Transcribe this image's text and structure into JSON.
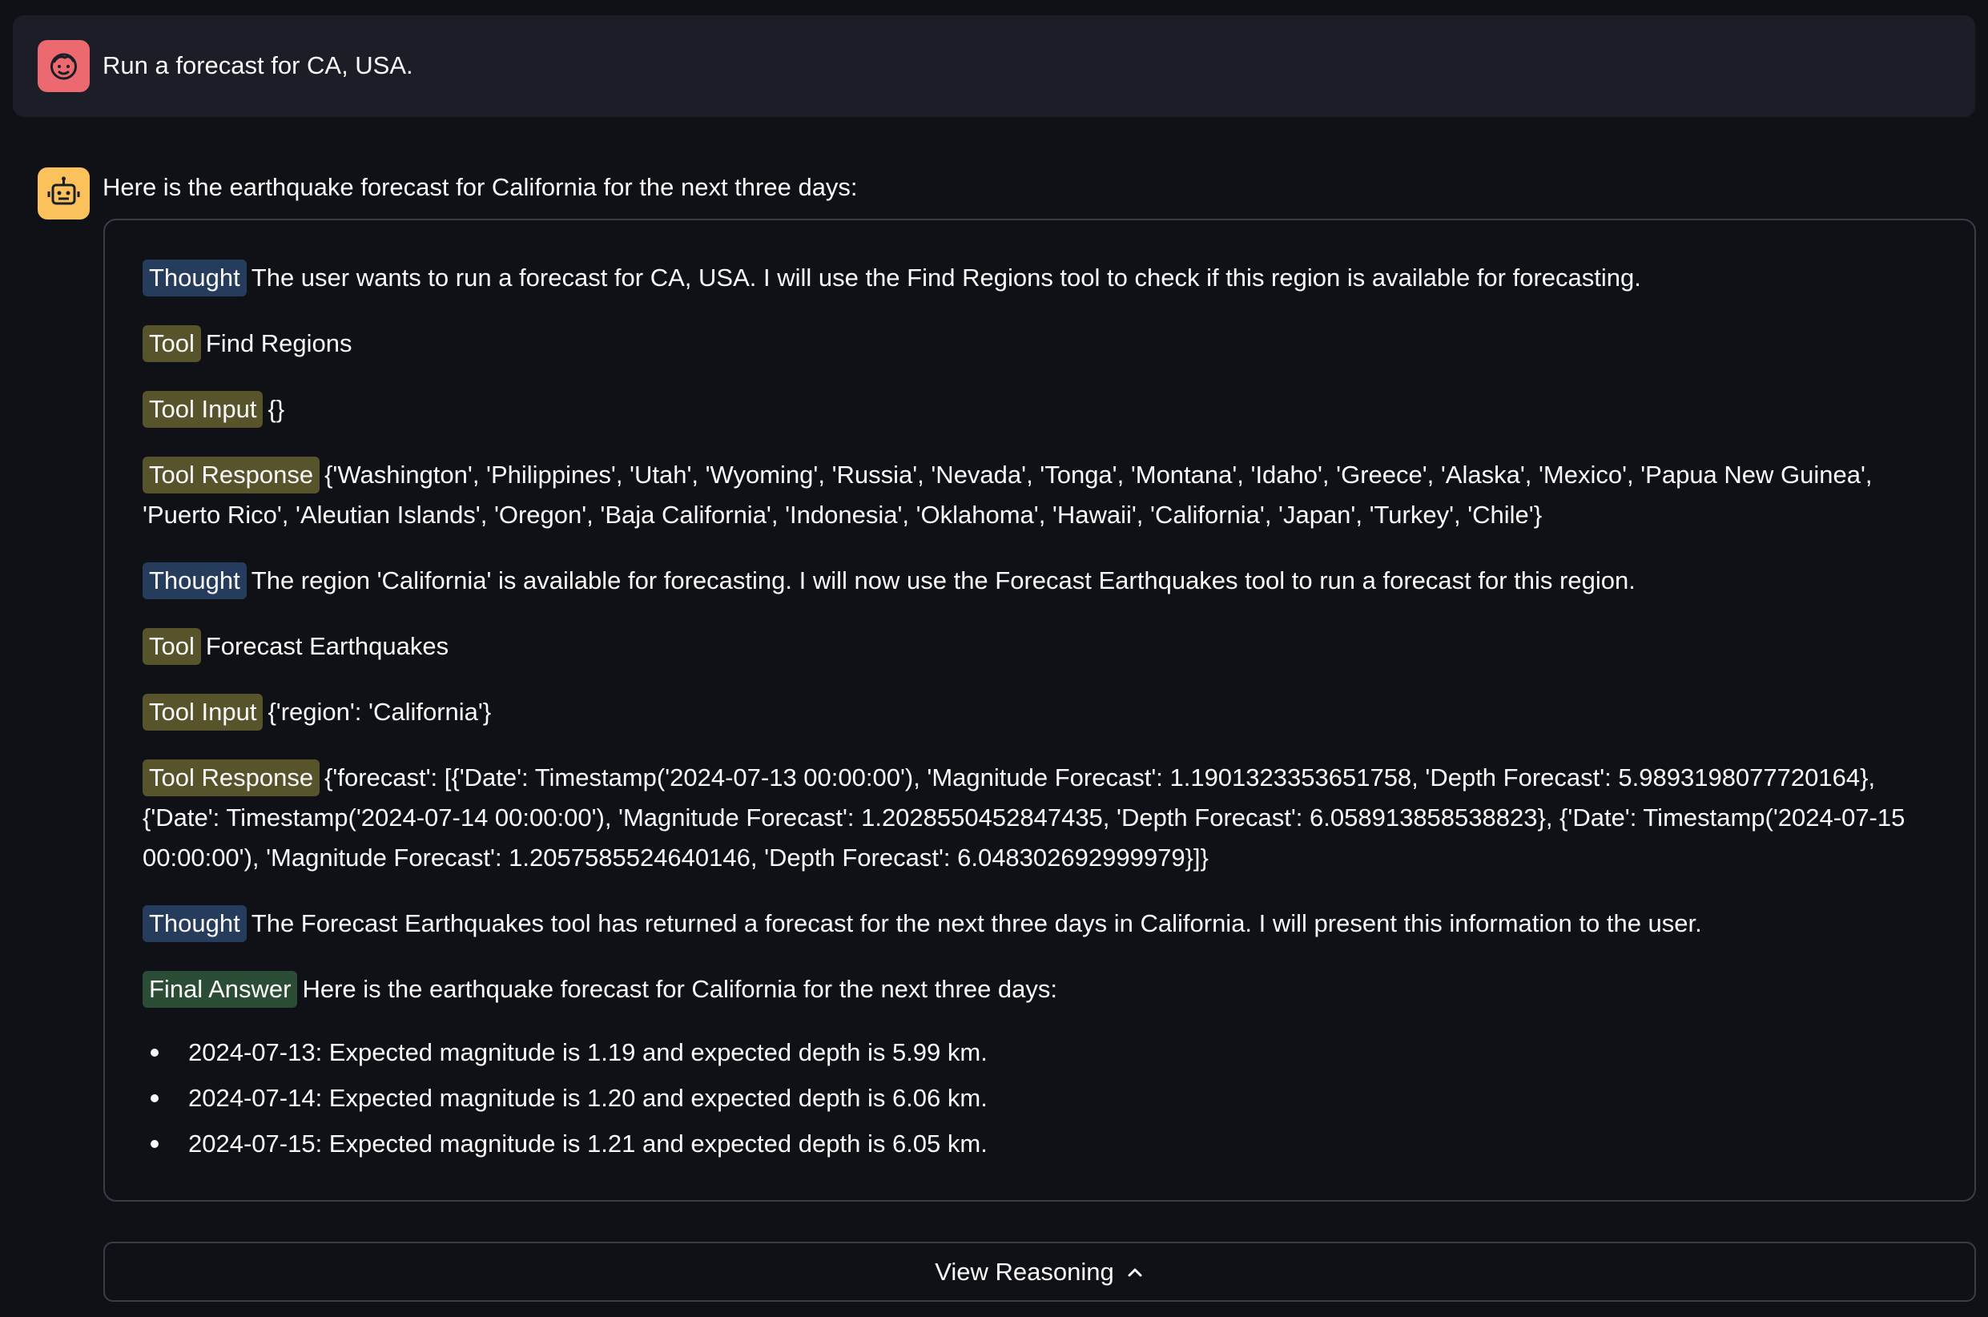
{
  "user_message": {
    "avatar_icon": "face-smile-icon",
    "text": "Run a forecast for CA, USA."
  },
  "assistant_message": {
    "avatar_icon": "robot-icon",
    "text": "Here is the earthquake forecast for California for the next three days:"
  },
  "reasoning": {
    "steps": [
      {
        "tag": "Thought",
        "text": "The user wants to run a forecast for CA, USA. I will use the Find Regions tool to check if this region is available for forecasting."
      },
      {
        "tag": "Tool",
        "text": "Find Regions"
      },
      {
        "tag": "Tool Input",
        "text": "{}"
      },
      {
        "tag": "Tool Response",
        "text": "{'Washington', 'Philippines', 'Utah', 'Wyoming', 'Russia', 'Nevada', 'Tonga', 'Montana', 'Idaho', 'Greece', 'Alaska', 'Mexico', 'Papua New Guinea', 'Puerto Rico', 'Aleutian Islands', 'Oregon', 'Baja California', 'Indonesia', 'Oklahoma', 'Hawaii', 'California', 'Japan', 'Turkey', 'Chile'}"
      },
      {
        "tag": "Thought",
        "text": "The region 'California' is available for forecasting. I will now use the Forecast Earthquakes tool to run a forecast for this region."
      },
      {
        "tag": "Tool",
        "text": "Forecast Earthquakes"
      },
      {
        "tag": "Tool Input",
        "text": "{'region': 'California'}"
      },
      {
        "tag": "Tool Response",
        "text": "{'forecast': [{'Date': Timestamp('2024-07-13 00:00:00'), 'Magnitude Forecast': 1.1901323353651758, 'Depth Forecast': 5.9893198077720164}, {'Date': Timestamp('2024-07-14 00:00:00'), 'Magnitude Forecast': 1.2028550452847435, 'Depth Forecast': 6.058913858538823}, {'Date': Timestamp('2024-07-15 00:00:00'), 'Magnitude Forecast': 1.2057585524640146, 'Depth Forecast': 6.048302692999979}]}"
      },
      {
        "tag": "Thought",
        "text": "The Forecast Earthquakes tool has returned a forecast for the next three days in California. I will present this information to the user."
      },
      {
        "tag": "Final Answer",
        "text": "Here is the earthquake forecast for California for the next three days:"
      }
    ],
    "answer_items": [
      "2024-07-13: Expected magnitude is 1.19 and expected depth is 5.99 km.",
      "2024-07-14: Expected magnitude is 1.20 and expected depth is 6.06 km.",
      "2024-07-15: Expected magnitude is 1.21 and expected depth is 6.05 km."
    ]
  },
  "view_reasoning_button": {
    "label": "View Reasoning",
    "icon": "chevron-up-icon"
  },
  "colors": {
    "background": "#0f1117",
    "user_avatar": "#ec6a6f",
    "bot_avatar": "#fbc15a",
    "thought_tag": "#263c5c",
    "tool_tag": "#57532b",
    "final_tag": "#2b4d35"
  }
}
